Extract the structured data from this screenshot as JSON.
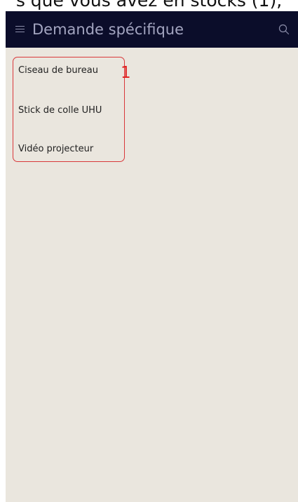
{
  "caption": "s que vous avez en stocks (1),",
  "header": {
    "title": "Demande spécifique",
    "menu_icon": "hamburger-menu-icon",
    "search_icon": "search-icon"
  },
  "items": [
    {
      "label": "Ciseau de bureau"
    },
    {
      "label": "Stick de colle UHU"
    },
    {
      "label": "Vidéo projecteur"
    }
  ],
  "annotation": {
    "number": "1",
    "color": "#e02020"
  },
  "colors": {
    "header_bg": "#0b0d2a",
    "content_bg": "#eae6de",
    "highlight_border": "#d9383a"
  }
}
